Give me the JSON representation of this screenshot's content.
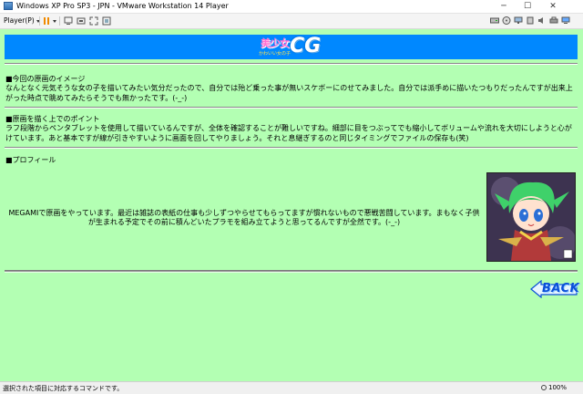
{
  "window": {
    "title": "Windows XP Pro SP3 - JPN - VMware Workstation 14 Player",
    "minimize_glyph": "─",
    "maximize_glyph": "☐",
    "close_glyph": "✕"
  },
  "toolbar": {
    "player_menu": "Player(P)",
    "icons": [
      "pause-icon",
      "send-ctrl-alt-del-icon",
      "removable-devices-icon",
      "fullscreen-icon",
      "unity-icon"
    ],
    "tray_icons": [
      "hdd-icon",
      "cdrom-icon",
      "network-icon",
      "usb-icon",
      "sound-icon",
      "printer-icon",
      "display-icon"
    ]
  },
  "page": {
    "logo_kanji": "美少女",
    "logo_cg": "CG",
    "logo_sub": "かわいい女の子",
    "sections": [
      {
        "title": "■今回の原画のイメージ",
        "body": "なんとなく元気そうな女の子を描いてみたい気分だったので、自分では殆ど乗った事が無いスケボーにのせてみました。自分では派手めに描いたつもりだったんですが出来上がった時点で眺めてみたらそうでも無かったです。(-_-)"
      },
      {
        "title": "■原画を描く上でのポイント",
        "body": "ラフ段階からペンタブレットを使用して描いているんですが、全体を確認することが難しいですね。細部に目をつぶってでも縮小してボリュームや流れを大切にしようと心がけています。あと基本ですが線が引きやすいように画面を回してやりましょう。それと息継ぎするのと同じタイミングでファイルの保存も(笑)"
      },
      {
        "title": "■プロフィール",
        "body": "MEGAMIで原画をやっています。最近は雑誌の表紙の仕事も少しずつやらせてもらってますが慣れないもので悪戦苦闘しています。まもなく子供が生まれる予定でその前に積んどいたプラモを組み立てようと思ってるんですが全然です。(-_-)"
      }
    ],
    "back_label": "BACK",
    "portrait_icon": "anime-girl-portrait"
  },
  "statusbar": {
    "text": "選択された項目に対応するコマンドです。",
    "zoom": "100%"
  },
  "colors": {
    "page_bg": "#b3ffb3",
    "banner_bg": "#0088ff",
    "back_text": "#0a4fd8"
  }
}
